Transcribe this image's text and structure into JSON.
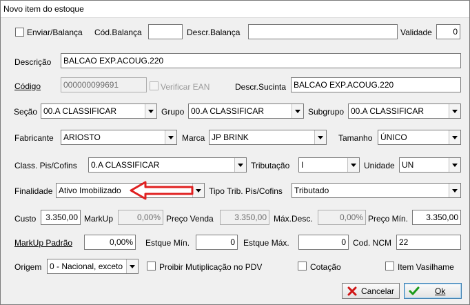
{
  "window": {
    "title": "Novo item do estoque"
  },
  "row1": {
    "enviar_balanca_label": "Enviar/Balança",
    "cod_balanca_label": "Cód.Balança",
    "cod_balanca_value": "",
    "descr_balanca_label": "Descr.Balança",
    "descr_balanca_value": "",
    "validade_label": "Validade",
    "validade_value": "0"
  },
  "descricao": {
    "label": "Descrição",
    "value": "BALCAO EXP.ACOUG.220"
  },
  "codigo": {
    "label": "Código",
    "value": "000000099691",
    "verificar_ean_label": "Verificar EAN",
    "descr_sucinta_label": "Descr.Sucinta",
    "descr_sucinta_value": "BALCAO EXP.ACOUG.220"
  },
  "secao_row": {
    "secao_label": "Seção",
    "secao_value": "00.A CLASSIFICAR",
    "grupo_label": "Grupo",
    "grupo_value": "00.A CLASSIFICAR",
    "subgrupo_label": "Subgrupo",
    "subgrupo_value": "00.A CLASSIFICAR"
  },
  "fabricante_row": {
    "fabricante_label": "Fabricante",
    "fabricante_value": "ARIOSTO",
    "marca_label": "Marca",
    "marca_value": "JP BRINK",
    "tamanho_label": "Tamanho",
    "tamanho_value": "ÚNICO"
  },
  "pis_row": {
    "class_label": "Class. Pis/Cofins",
    "class_value": "0.A CLASSIFICAR",
    "tributacao_label": "Tributação",
    "tributacao_value": "I",
    "unidade_label": "Unidade",
    "unidade_value": "UN"
  },
  "finalidade_row": {
    "finalidade_label": "Finalidade",
    "finalidade_value": "Ativo Imobilizado",
    "tipo_trib_label": "Tipo Trib. Pis/Cofins",
    "tipo_trib_value": "Tributado"
  },
  "prices_row": {
    "custo_label": "Custo",
    "custo_value": "3.350,00",
    "markup_label": "MarkUp",
    "markup_value": "0,00%",
    "preco_venda_label": "Preço Venda",
    "preco_venda_value": "3.350,00",
    "max_desc_label": "Máx.Desc.",
    "max_desc_value": "0,00%",
    "preco_min_label": "Preço Mín.",
    "preco_min_value": "3.350,00"
  },
  "stock_row": {
    "markup_padrao_label": "MarkUp Padrão",
    "markup_padrao_value": "0,00%",
    "estoque_min_label": "Estque Mín.",
    "estoque_min_value": "0",
    "estoque_max_label": "Estque Máx.",
    "estoque_max_value": "0",
    "cod_ncm_label": "Cod. NCM",
    "cod_ncm_value": "22"
  },
  "origem_row": {
    "origem_label": "Origem",
    "origem_value": "0 - Nacional, exceto",
    "proibir_label": "Proibir Mutiplicação no PDV",
    "cotacao_label": "Cotação",
    "item_vasilhame_label": "Item Vasilhame"
  },
  "buttons": {
    "cancelar_label": "Cancelar",
    "ok_label": "Ok"
  },
  "colors": {
    "annotation_arrow": "#e02020",
    "ok_icon": "#1a9a1a",
    "cancel_icon": "#d01515"
  }
}
